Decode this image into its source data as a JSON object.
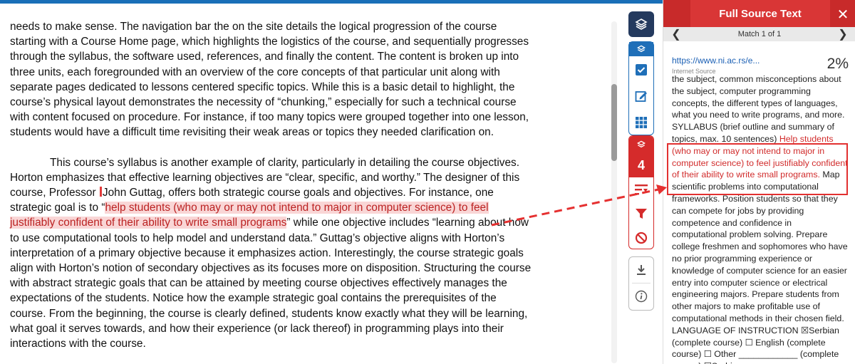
{
  "document": {
    "paragraph1": "needs to make sense. The navigation bar the on the site details the logical progression of the course starting with a Course Home page, which highlights the logistics of the course, and sequentially progresses through the syllabus, the software used, references, and finally the content.  The content is broken up into three units, each foregrounded with an overview of the core concepts of that particular unit along with separate pages dedicated to lessons centered specific topics. While this is a basic detail to highlight, the course’s physical layout demonstrates the necessity of “chunking,” especially for such a technical course with content focused on procedure. For instance, if too many topics were grouped together into one lesson, students would have a difficult time revisiting their weak areas or topics they needed clarification on.",
    "paragraph2_before": "This course’s syllabus is another example of clarity, particularly in detailing the course objectives. Horton emphasizes that effective learning objectives are “clear, specific, and worthy.” The designer of this course, Professor ",
    "paragraph2_name": "John Guttag, offers both strategic course goals and objectives. For instance, one strategic goal is to “",
    "paragraph2_highlight": "help students (who may or may not intend to major in computer science) to feel justifiably confident of their ability to write small programs",
    "paragraph2_after": "” while one objective includes “learning about how to use computational tools to help model and understand data.” Guttag’s objective aligns with Horton’s interpretation of a primary objective because it emphasizes action. Interestingly, the course strategic goals align with Horton’s notion of secondary objectives as its focuses more on disposition. Structuring the course with abstract strategic goals that can be attained by meeting course objectives effectively manages the expectations of the students. Notice how the example strategic goal contains the prerequisites of the course. From the beginning, the course is clearly defined, students know exactly what they will be learning, what goal it serves towards, and how their experience (or lack thereof) in programming plays into their interactions with the course."
  },
  "toolbar": {
    "match_count": "4"
  },
  "panel": {
    "title": "Full Source Text",
    "close": "✕",
    "match_label": "Match 1 of 1",
    "prev": "❮",
    "next": "❯",
    "source_url": "https://www.ni.ac.rs/e...",
    "source_type": "Internet Source",
    "source_percent": "2%",
    "text_before": "the subject, common misconceptions about the subject, computer programming concepts, the different types of languages, what you need to write programs, and more. SYLLABUS (brief outline and summary of topics, max. 10 sentences) ",
    "text_match": "Help students (who may or may not intend to major in computer science) to feel justifiably confident of their ability to write small programs.",
    "text_after": " Map scientific problems into computational frameworks. Position students so that they can compete for jobs by providing competence and confidence in computational problem solving. Prepare college freshmen and sophomores who have no prior programming experience or knowledge of computer science for an easier entry into computer science or electrical engineering majors. Prepare students from other majors to make profitable use of computational methods in their chosen field. LANGUAGE OF INSTRUCTION ☒Serbian (complete course) ☐ English (complete course) ☐ Other ____________ (complete course) ☐Serbian"
  },
  "colors": {
    "accent_red": "#d52b2b",
    "accent_blue": "#1f6fb8",
    "highlight": "#f9d6d6"
  }
}
